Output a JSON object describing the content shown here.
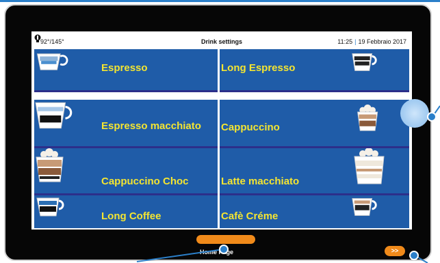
{
  "status": {
    "temperature": "92°/145°",
    "title": "Drink settings",
    "time": "11:25",
    "date": "19 Febbraio 2017"
  },
  "drinks": [
    {
      "label": "Espresso",
      "icon": "espresso-cup-icon"
    },
    {
      "label": "Long Espresso",
      "icon": "long-espresso-cup-icon"
    },
    {
      "label": "Espresso macchiato",
      "icon": "espresso-macchiato-cup-icon"
    },
    {
      "label": "Cappuccino",
      "icon": "cappuccino-cup-icon"
    },
    {
      "label": "Cappuccino Choc",
      "icon": "cappuccino-choc-cup-icon"
    },
    {
      "label": "Latte macchiato",
      "icon": "latte-macchiato-cup-icon"
    },
    {
      "label": "Long Coffee",
      "icon": "long-coffee-cup-icon"
    },
    {
      "label": "Cafè Créme",
      "icon": "cafe-creme-cup-icon"
    }
  ],
  "navigation": {
    "home_label": "Home Page",
    "next_label": ">>"
  },
  "colors": {
    "tile_bg": "#1f5ca8",
    "tile_text": "#f4e531",
    "accent": "#f08a1a",
    "callout": "#2b7fc9"
  }
}
